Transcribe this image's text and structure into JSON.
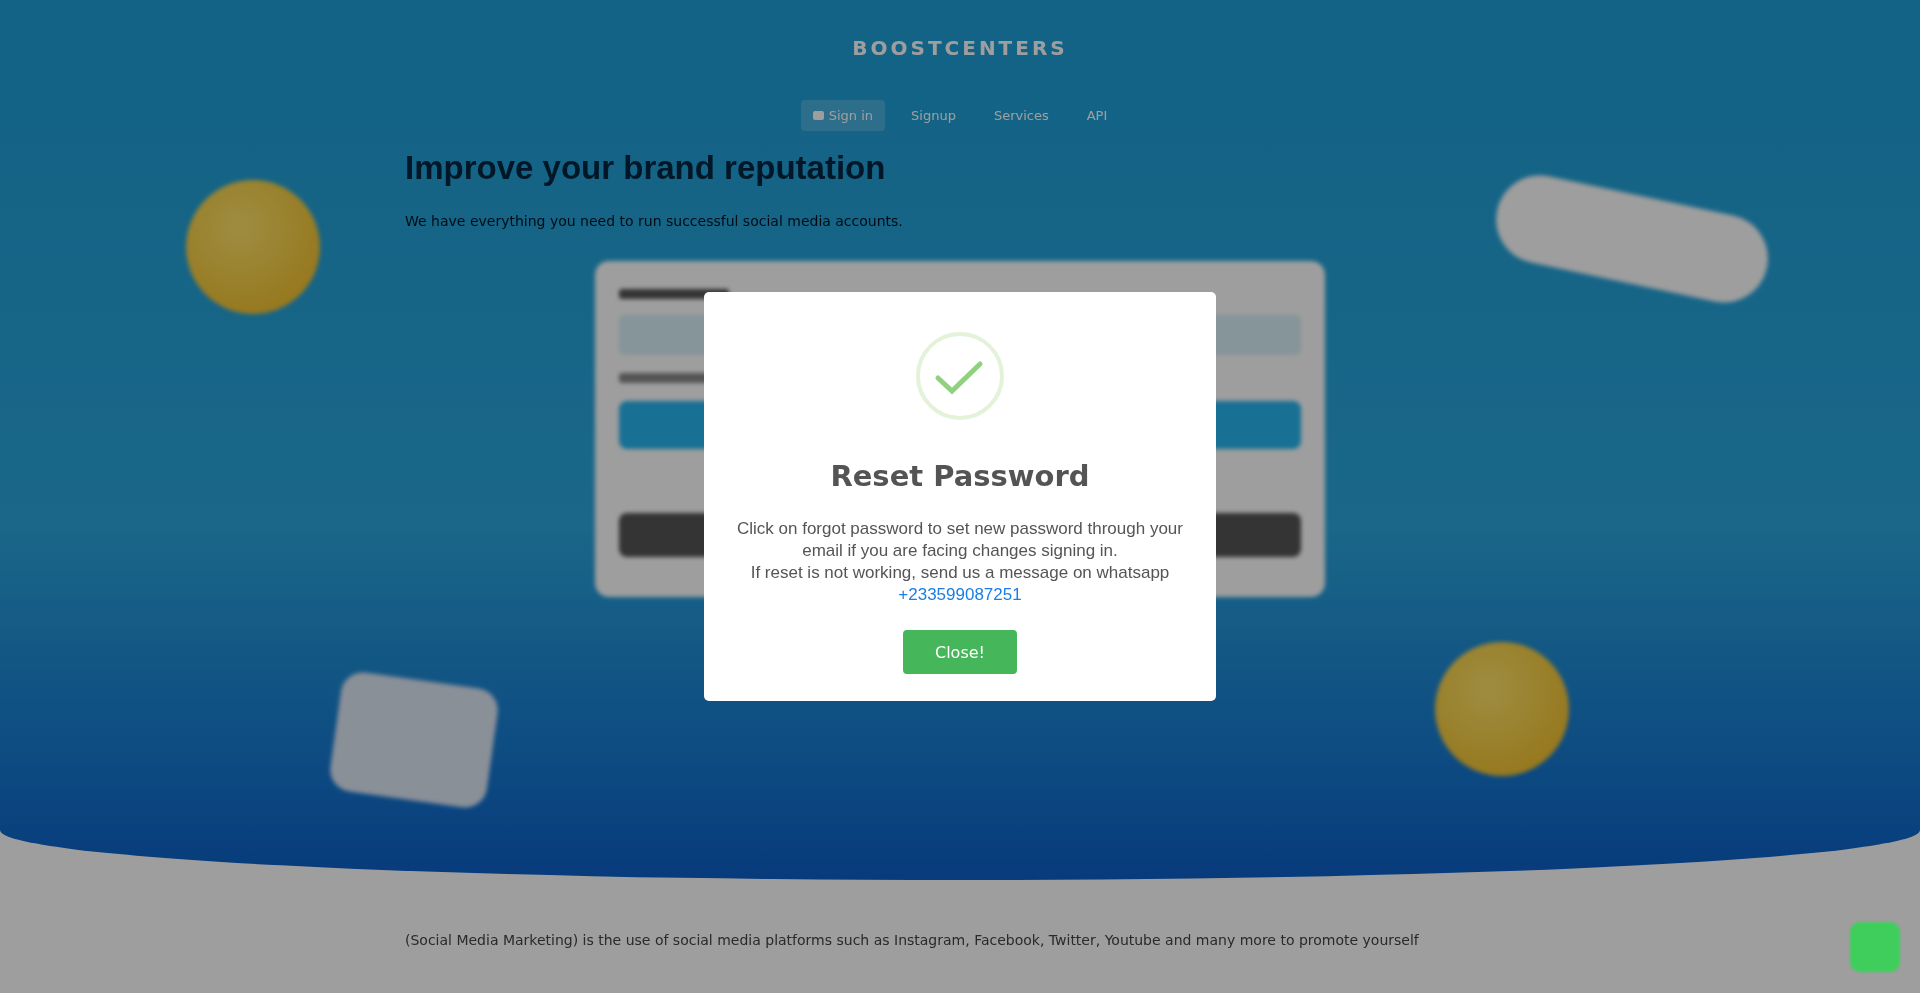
{
  "header": {
    "brand": "BOOSTCENTERS",
    "nav": [
      {
        "label": "Sign in",
        "selected": true,
        "kind": "icon"
      },
      {
        "label": "Signup",
        "selected": false,
        "kind": "plain"
      },
      {
        "label": "Services",
        "selected": false,
        "kind": "plain"
      },
      {
        "label": "API",
        "selected": false,
        "kind": "plain"
      }
    ]
  },
  "hero": {
    "title": "Improve your brand reputation",
    "subtitle": "We have everything you need to run successful social media accounts."
  },
  "modal": {
    "title": "Reset Password",
    "message": "Click on forgot password to set new password through your email if you are facing changes signing in.",
    "message_2": "If reset is not working, send us a message on whatsapp",
    "link": "+233599087251",
    "button": "Close!"
  },
  "footer": {
    "paragraph": "(Social Media Marketing) is the use of social media platforms such as Instagram, Facebook, Twitter, Youtube and many more to promote yourself"
  }
}
